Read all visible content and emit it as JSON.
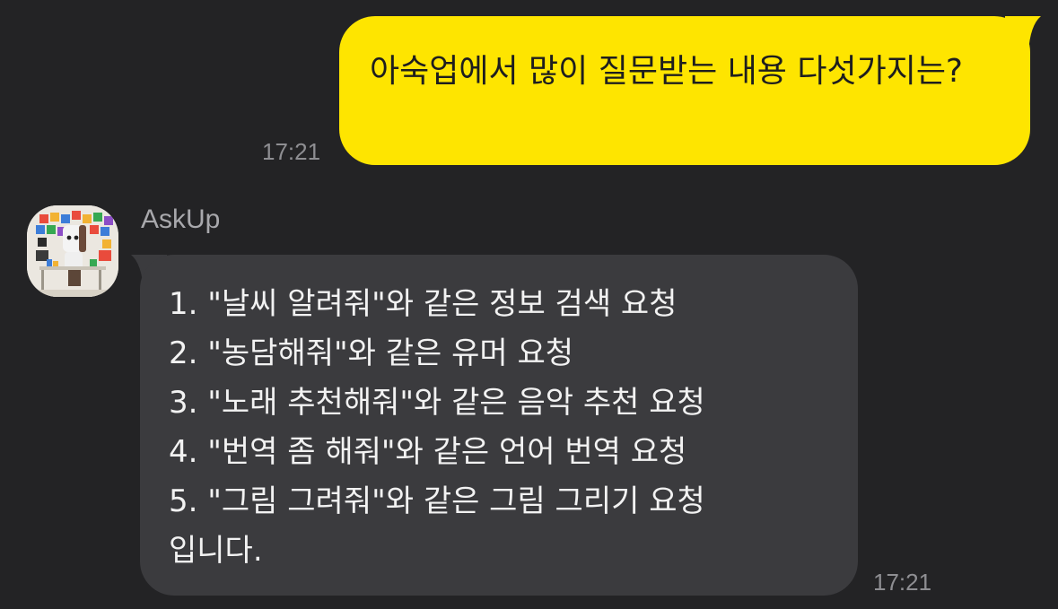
{
  "conversation": {
    "outgoing": {
      "text": "아숙업에서 많이 질문받는 내용 다섯가지는?",
      "time": "17:21"
    },
    "incoming": {
      "sender": "AskUp",
      "avatar_icon": "askup-robot-avatar-icon",
      "lines": [
        "1. \"날씨 알려줘\"와 같은 정보 검색 요청",
        "2. \"농담해줘\"와 같은 유머 요청",
        "3. \"노래 추천해줘\"와 같은 음악 추천 요청",
        "4. \"번역 좀 해줘\"와 같은 언어 번역 요청",
        "5. \"그림 그려줘\"와 같은 그림 그리기 요청",
        "입니다."
      ],
      "time": "17:21"
    }
  },
  "colors": {
    "background": "#232325",
    "outgoing_bubble": "#FEE500",
    "incoming_bubble": "#3B3B3E",
    "timestamp": "#8E8E92"
  }
}
